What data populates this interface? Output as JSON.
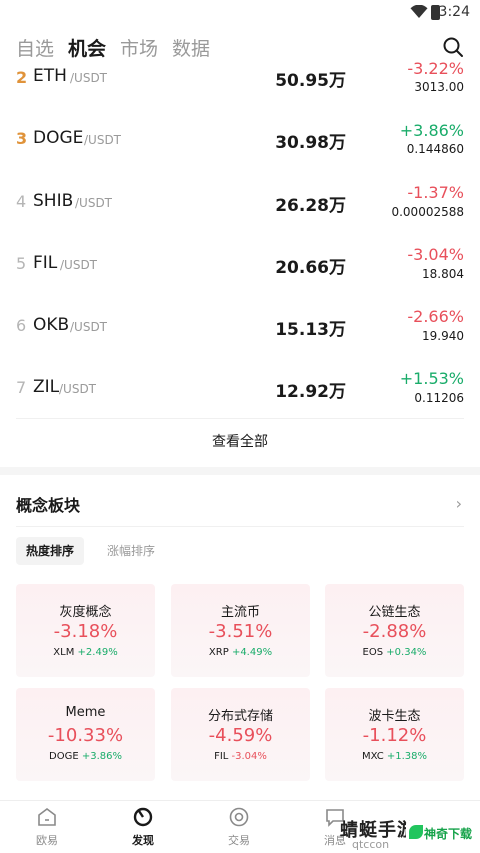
{
  "status": {
    "time": "3:24"
  },
  "nav": {
    "tabs": [
      "自选",
      "机会",
      "市场",
      "数据"
    ],
    "active": 1
  },
  "coins": [
    {
      "rank": "2",
      "symbol": "ETH",
      "quote": "/USDT",
      "volume": "50.95万",
      "change": "-3.22%",
      "price": "3013.00",
      "dir": "down"
    },
    {
      "rank": "3",
      "symbol": "DOGE",
      "quote": "/USDT",
      "volume": "30.98万",
      "change": "+3.86%",
      "price": "0.144860",
      "dir": "up"
    },
    {
      "rank": "4",
      "symbol": "SHIB",
      "quote": "/USDT",
      "volume": "26.28万",
      "change": "-1.37%",
      "price": "0.00002588",
      "dir": "down"
    },
    {
      "rank": "5",
      "symbol": "FIL",
      "quote": "/USDT",
      "volume": "20.66万",
      "change": "-3.04%",
      "price": "18.804",
      "dir": "down"
    },
    {
      "rank": "6",
      "symbol": "OKB",
      "quote": "/USDT",
      "volume": "15.13万",
      "change": "-2.66%",
      "price": "19.940",
      "dir": "down"
    },
    {
      "rank": "7",
      "symbol": "ZIL",
      "quote": "/USDT",
      "volume": "12.92万",
      "change": "+1.53%",
      "price": "0.11206",
      "dir": "up"
    }
  ],
  "view_all": "查看全部",
  "concept": {
    "title": "概念板块",
    "filters": [
      "热度排序",
      "涨幅排序"
    ],
    "cards": [
      {
        "name": "灰度概念",
        "change": "-3.18%",
        "lead_symbol": "XLM",
        "lead_change": "+2.49%",
        "lead_dir": "up"
      },
      {
        "name": "主流币",
        "change": "-3.51%",
        "lead_symbol": "XRP",
        "lead_change": "+4.49%",
        "lead_dir": "up"
      },
      {
        "name": "公链生态",
        "change": "-2.88%",
        "lead_symbol": "EOS",
        "lead_change": "+0.34%",
        "lead_dir": "up"
      },
      {
        "name": "Meme",
        "change": "-10.33%",
        "lead_symbol": "DOGE",
        "lead_change": "+3.86%",
        "lead_dir": "up"
      },
      {
        "name": "分布式存储",
        "change": "-4.59%",
        "lead_symbol": "FIL",
        "lead_change": "-3.04%",
        "lead_dir": "down"
      },
      {
        "name": "波卡生态",
        "change": "-1.12%",
        "lead_symbol": "MXC",
        "lead_change": "+1.38%",
        "lead_dir": "up"
      }
    ]
  },
  "bottom_nav": [
    {
      "label": "欧易",
      "icon": "home-icon"
    },
    {
      "label": "发现",
      "icon": "discover-icon"
    },
    {
      "label": "交易",
      "icon": "trade-icon"
    },
    {
      "label": "消息",
      "icon": "message-icon"
    }
  ],
  "watermark": {
    "title": "蜻蜓手游",
    "sub": "qtccon",
    "badge": "神奇下载"
  },
  "colors": {
    "up": "#1aac6a",
    "down": "#e8505b",
    "rank_top": "#e0933a"
  }
}
